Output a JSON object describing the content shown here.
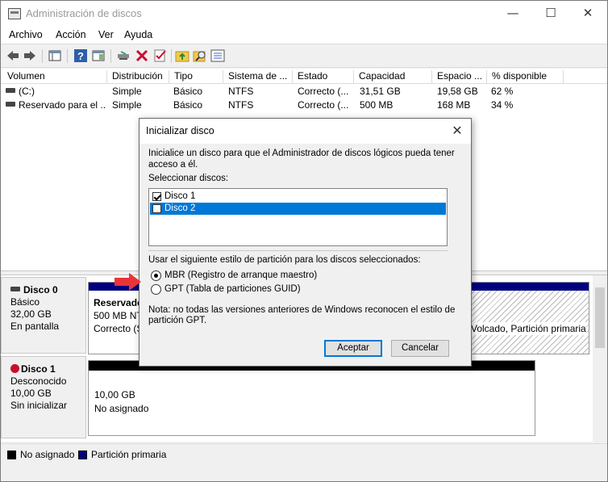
{
  "window": {
    "title": "Administración de discos",
    "controls": {
      "minimize": "—",
      "maximize": "☐",
      "close": "✕"
    }
  },
  "menu": [
    "Archivo",
    "Acción",
    "Ver",
    "Ayuda"
  ],
  "toolbar": {
    "icons": [
      "back-icon",
      "forward-icon",
      "console-tree-icon",
      "help-icon",
      "properties-pane-icon",
      "connect-icon",
      "delete-icon",
      "check-icon",
      "up-folder-icon",
      "search-icon",
      "list-icon"
    ]
  },
  "volumes": {
    "columns": [
      "Volumen",
      "Distribución",
      "Tipo",
      "Sistema de ...",
      "Estado",
      "Capacidad",
      "Espacio ...",
      "% disponible"
    ],
    "rows": [
      [
        "(C:)",
        "Simple",
        "Básico",
        "NTFS",
        "Correcto (...",
        "31,51 GB",
        "19,58 GB",
        "62 %"
      ],
      [
        "Reservado para el ...",
        "Simple",
        "Básico",
        "NTFS",
        "Correcto (...",
        "500 MB",
        "168 MB",
        "34 %"
      ]
    ]
  },
  "disks": [
    {
      "name": "Disco 0",
      "type": "Básico",
      "size": "32,00 GB",
      "status": "En pantalla",
      "partitions": [
        {
          "title": "Reservado",
          "line1": "500 MB NTF",
          "line2": "Correcto (S"
        },
        {
          "trailing": "Volcado, Partición primaria"
        }
      ]
    },
    {
      "name": "Disco 1",
      "type": "Desconocido",
      "size": "10,00 GB",
      "status": "Sin inicializar",
      "partitions": [
        {
          "line1": "10,00 GB",
          "line2": "No asignado"
        }
      ]
    }
  ],
  "legend": [
    {
      "label": "No asignado",
      "color": "#000000"
    },
    {
      "label": "Partición primaria",
      "color": "#00007f"
    }
  ],
  "dialog": {
    "title": "Inicializar disco",
    "intro_line1": "Inicialice un disco para que el Administrador de discos lógicos pueda tener",
    "intro_line2": "acceso a él.",
    "select_label": "Seleccionar discos:",
    "disk_items": [
      {
        "label": "Disco 1",
        "checked": true,
        "selected": false
      },
      {
        "label": "Disco 2",
        "checked": false,
        "selected": true
      }
    ],
    "style_label": "Usar el siguiente estilo de partición para los discos seleccionados:",
    "options": [
      {
        "label": "MBR (Registro de arranque maestro)",
        "selected": true
      },
      {
        "label": "GPT (Tabla de particiones GUID)",
        "selected": false
      }
    ],
    "note_line1": "Nota: no todas las versiones anteriores de Windows reconocen el estilo de",
    "note_line2": "partición GPT.",
    "ok_label": "Aceptar",
    "cancel_label": "Cancelar"
  },
  "colors": {
    "accent": "#0078d7",
    "primary_partition": "#00007f",
    "unallocated": "#000000",
    "arrow": "#e8353a"
  }
}
